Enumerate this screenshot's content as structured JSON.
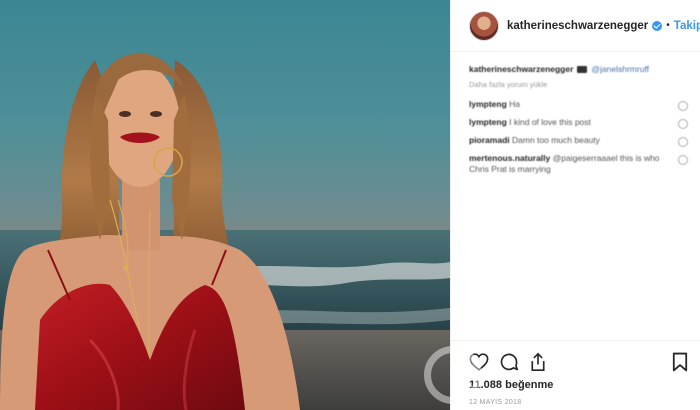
{
  "post": {
    "username": "katherineschwarzenegger",
    "follow_label": "Takip Et",
    "dot": "•",
    "caption": {
      "user": "katherineschwarzenegger",
      "mention": "@janelshrmruff",
      "sub": "Daha fazla yorum yükle"
    },
    "comments": [
      {
        "user": "lympteng",
        "text": "Ha"
      },
      {
        "user": "lympteng",
        "text": "I kind of love this post"
      },
      {
        "user": "pioramadi",
        "text": "Damn too much beauty"
      },
      {
        "user": "mertenous.naturally",
        "text": "@paigeserraaael this is who Chris Prat is marrying"
      }
    ],
    "likes": "11.088",
    "likes_label": "beğenme",
    "date": "12 MAYIS 2018"
  },
  "icons": {
    "like": "heart-icon",
    "comment": "comment-icon",
    "share": "share-icon",
    "save": "bookmark-icon",
    "verified": "verified-badge-icon"
  },
  "colors": {
    "link_blue": "#3897f0",
    "dress_red": "#b3141c"
  }
}
